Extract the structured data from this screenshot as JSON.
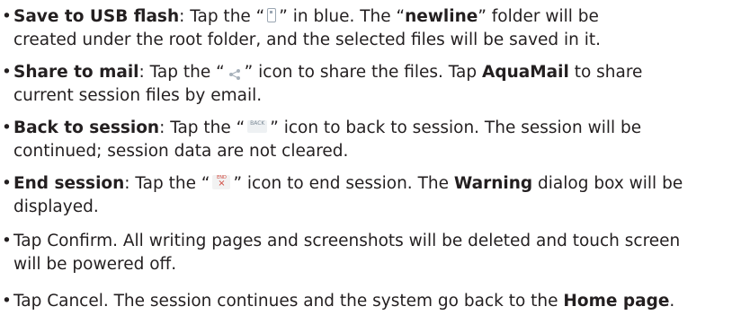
{
  "bullet_char": "•",
  "items": [
    {
      "label": "Save to USB flash",
      "l1_a": ": Tap the “",
      "l1_b": "” in blue. The “",
      "l1_bold": "newline",
      "l1_c": "” folder will be",
      "l2": "created under the root folder, and the selected files will be saved in it.",
      "icon": "usb-flash-icon"
    },
    {
      "label": "Share to mail",
      "l1_a": ": Tap the “",
      "l1_b": "” icon to share the files. Tap ",
      "l1_bold": "AquaMail",
      "l1_c": " to share",
      "l2": "current session files by email.",
      "icon": "share-icon"
    },
    {
      "label": "Back to session",
      "l1_a": ": Tap the “",
      "l1_b": "” icon to back to session. The session will be",
      "l2": "continued; session data are not cleared.",
      "icon": "back-icon",
      "icon_text": "BACK"
    },
    {
      "label": "End session",
      "l1_a": ": Tap the “",
      "l1_b": "” icon to end session. The ",
      "l1_bold": "Warning",
      "l1_c": " dialog box will be",
      "l2": "displayed.",
      "icon": "end-icon",
      "icon_text": "END",
      "icon_mark": "×"
    },
    {
      "l1": "Tap Confirm. All writing pages and screenshots will be deleted and touch screen",
      "l2": "will be powered off."
    },
    {
      "l1_a": "Tap Cancel. The session continues and the system go back to the ",
      "l1_bold": "Home page",
      "l1_c": "."
    }
  ]
}
